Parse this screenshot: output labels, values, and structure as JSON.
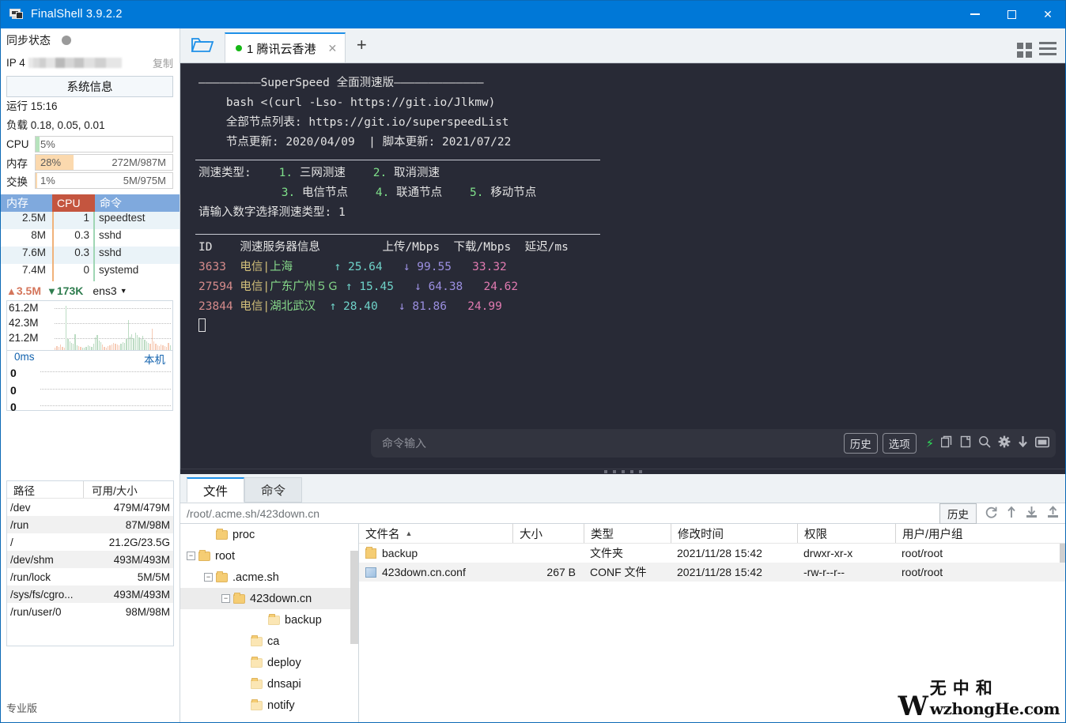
{
  "window": {
    "title": "FinalShell 3.9.2.2",
    "minimize": "—",
    "maximize": "□",
    "close": "✕"
  },
  "sidebar": {
    "sync_label": "同步状态",
    "ip_label": "IP 4",
    "copy_label": "复制",
    "sysinfo_button": "系统信息",
    "uptime": "运行 15:16",
    "load": "负载 0.18, 0.05, 0.01",
    "meters": [
      {
        "label": "CPU",
        "percent": "5%",
        "value": "",
        "fill_color": "#b7e3bd",
        "fill_width": "3%"
      },
      {
        "label": "内存",
        "percent": "28%",
        "value": "272M/987M",
        "fill_color": "#fbd9ae",
        "fill_width": "28%"
      },
      {
        "label": "交换",
        "percent": "1%",
        "value": "5M/975M",
        "fill_color": "#fbd9ae",
        "fill_width": "1%"
      }
    ],
    "proc_headers": {
      "mem": "内存",
      "cpu": "CPU",
      "cmd": "命令"
    },
    "processes": [
      {
        "mem": "2.5M",
        "cpu": "1",
        "cmd": "speedtest"
      },
      {
        "mem": "8M",
        "cpu": "0.3",
        "cmd": "sshd"
      },
      {
        "mem": "7.6M",
        "cpu": "0.3",
        "cmd": "sshd"
      },
      {
        "mem": "7.4M",
        "cpu": "0",
        "cmd": "systemd"
      }
    ],
    "network": {
      "up": "3.5M",
      "down": "173K",
      "interface": "ens3",
      "y_labels": [
        "61.2M",
        "42.3M",
        "21.2M"
      ]
    },
    "ping": {
      "unit": "0ms",
      "host": "本机",
      "y_labels": [
        "0",
        "0",
        "0"
      ]
    },
    "disk_headers": {
      "path": "路径",
      "size": "可用/大小"
    },
    "disks": [
      {
        "path": "/dev",
        "size": "479M/479M"
      },
      {
        "path": "/run",
        "size": "87M/98M"
      },
      {
        "path": "/",
        "size": "21.2G/23.5G"
      },
      {
        "path": "/dev/shm",
        "size": "493M/493M"
      },
      {
        "path": "/run/lock",
        "size": "5M/5M"
      },
      {
        "path": "/sys/fs/cgro...",
        "size": "493M/493M"
      },
      {
        "path": "/run/user/0",
        "size": "98M/98M"
      }
    ],
    "edition": "专业版"
  },
  "tabbar": {
    "open_folder_icon": "open-folder-icon",
    "tab_label": "1 腾讯云香港",
    "tab_close": "✕",
    "new_tab": "+",
    "grid_icon": "grid-view-icon",
    "menu_icon": "hamburger-menu-icon"
  },
  "terminal": {
    "banner": "—————————SuperSpeed 全面测速版—————————————",
    "lines": [
      "    bash <(curl -Lso- https://git.io/Jlkmw)",
      "    全部节点列表: https://git.io/superspeedList",
      "    节点更新: 2020/04/09  | 脚本更新: 2021/07/22"
    ],
    "menu_label": "测速类型:",
    "menu_items": [
      {
        "num": "1.",
        "text": "三网测速"
      },
      {
        "num": "2.",
        "text": "取消测速"
      },
      {
        "num": "3.",
        "text": "电信节点"
      },
      {
        "num": "4.",
        "text": "联通节点"
      },
      {
        "num": "5.",
        "text": "移动节点"
      }
    ],
    "prompt": "请输入数字选择测速类型: 1",
    "table_headers": {
      "id": "ID",
      "server": "测速服务器信息",
      "upload": "上传/Mbps",
      "download": "下载/Mbps",
      "latency": "延迟/ms"
    },
    "rows": [
      {
        "id": "3633",
        "isp": "电信|",
        "loc": "上海",
        "upload": "↑ 25.64",
        "download": "↓ 99.55",
        "latency": "33.32"
      },
      {
        "id": "27594",
        "isp": "电信|",
        "loc": "广东广州５Ｇ",
        "upload": "↑ 15.45",
        "download": "↓ 64.38",
        "latency": "24.62"
      },
      {
        "id": "23844",
        "isp": "电信|",
        "loc": "湖北武汉",
        "upload": "↑ 28.40",
        "download": "↓ 81.86",
        "latency": "24.99"
      }
    ],
    "cmd_placeholder": "命令输入",
    "history_button": "历史",
    "options_button": "选项",
    "icons": [
      "lightning-icon",
      "copy-icon",
      "paste-icon",
      "search-icon",
      "gear-icon",
      "download-icon",
      "window-icon"
    ]
  },
  "filepanel": {
    "tabs": [
      {
        "label": "文件",
        "active": true
      },
      {
        "label": "命令",
        "active": false
      }
    ],
    "path": "/root/.acme.sh/423down.cn",
    "history_button": "历史",
    "toolbar_icons": [
      "refresh-icon",
      "upload-arrow-icon",
      "download-file-icon",
      "upload-file-icon"
    ],
    "tree": [
      {
        "label": "proc",
        "depth": 1,
        "expander": "",
        "selected": false
      },
      {
        "label": "root",
        "depth": 0,
        "expander": "−",
        "selected": false
      },
      {
        "label": ".acme.sh",
        "depth": 1,
        "expander": "−",
        "selected": false
      },
      {
        "label": "423down.cn",
        "depth": 2,
        "expander": "−",
        "selected": true
      },
      {
        "label": "backup",
        "depth": 4,
        "expander": "",
        "selected": false
      },
      {
        "label": "ca",
        "depth": 3,
        "expander": "",
        "selected": false
      },
      {
        "label": "deploy",
        "depth": 3,
        "expander": "",
        "selected": false
      },
      {
        "label": "dnsapi",
        "depth": 3,
        "expander": "",
        "selected": false
      },
      {
        "label": "notify",
        "depth": 3,
        "expander": "",
        "selected": false
      }
    ],
    "headers": {
      "name": "文件名",
      "sort": "▲",
      "size": "大小",
      "type": "类型",
      "mtime": "修改时间",
      "perm": "权限",
      "owner": "用户/用户组"
    },
    "files": [
      {
        "name": "backup",
        "size": "",
        "type": "文件夹",
        "mtime": "2021/11/28 15:42",
        "perm": "drwxr-xr-x",
        "owner": "root/root",
        "icon": "folder"
      },
      {
        "name": "423down.cn.conf",
        "size": "267 B",
        "type": "CONF 文件",
        "mtime": "2021/11/28 15:42",
        "perm": "-rw-r--r--",
        "owner": "root/root",
        "icon": "conf"
      }
    ]
  },
  "watermark": {
    "cn": "无中和",
    "en": "wzhongHe.com",
    "mark": "W"
  }
}
